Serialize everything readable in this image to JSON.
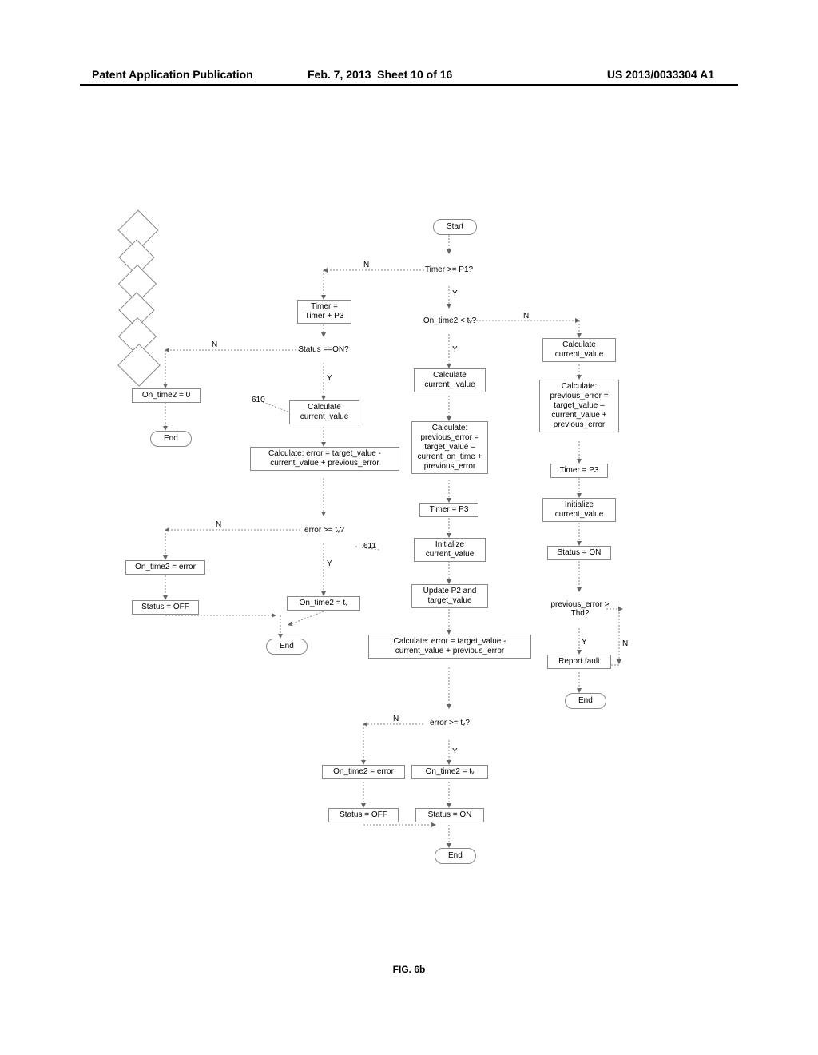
{
  "header": {
    "left": "Patent Application Publication",
    "date": "Feb. 7, 2013",
    "sheet": "Sheet 10 of 16",
    "pubnum": "US 2013/0033304 A1"
  },
  "figure_label": "FIG. 6b",
  "refs": {
    "r610": "610",
    "r611": "611"
  },
  "edges": {
    "Y": "Y",
    "N": "N"
  },
  "nodes": {
    "start": "Start",
    "d_timer_p1": "Timer >= P1?",
    "timer_plus_p3": "Timer = Timer + P3",
    "d_status_on": "Status ==ON?",
    "ontime2_zero": "On_time2 = 0",
    "end_left": "End",
    "calc_cv_a": "Calculate current_value",
    "calc_err_a": "Calculate: error = target_value - current_value + previous_error",
    "d_err_tv_a": "error >= tᵥ?",
    "ontime2_err_a": "On_time2 = error",
    "status_off_a": "Status = OFF",
    "ontime2_tv_a": "On_time2 = tᵥ",
    "end_mid": "End",
    "d_ontime2_tv": "On_time2 < tᵥ?",
    "calc_cv_b": "Calculate current_ value",
    "calc_prev_b": "Calculate: previous_error = target_value – current_on_time + previous_error",
    "timer_p3_b": "Timer = P3",
    "init_cv_b": "Initialize current_value",
    "update_p2": "Update P2 and target_value",
    "calc_err_b": "Calculate: error = target_value - current_value + previous_error",
    "d_err_tv_b": "error >= tᵥ?",
    "ontime2_err_b": "On_time2 = error",
    "status_off_b": "Status = OFF",
    "ontime2_tv_b": "On_time2 = tᵥ",
    "status_on_b": "Status = ON",
    "end_bot": "End",
    "calc_cv_c": "Calculate current_value",
    "calc_prev_c": "Calculate: previous_error = target_value – current_value + previous_error",
    "timer_p3_c": "Timer = P3",
    "init_cv_c": "Initialize current_value",
    "status_on_c": "Status = ON",
    "d_prev_thd": "previous_error > Thd?",
    "report_fault": "Report fault",
    "end_right": "End"
  }
}
